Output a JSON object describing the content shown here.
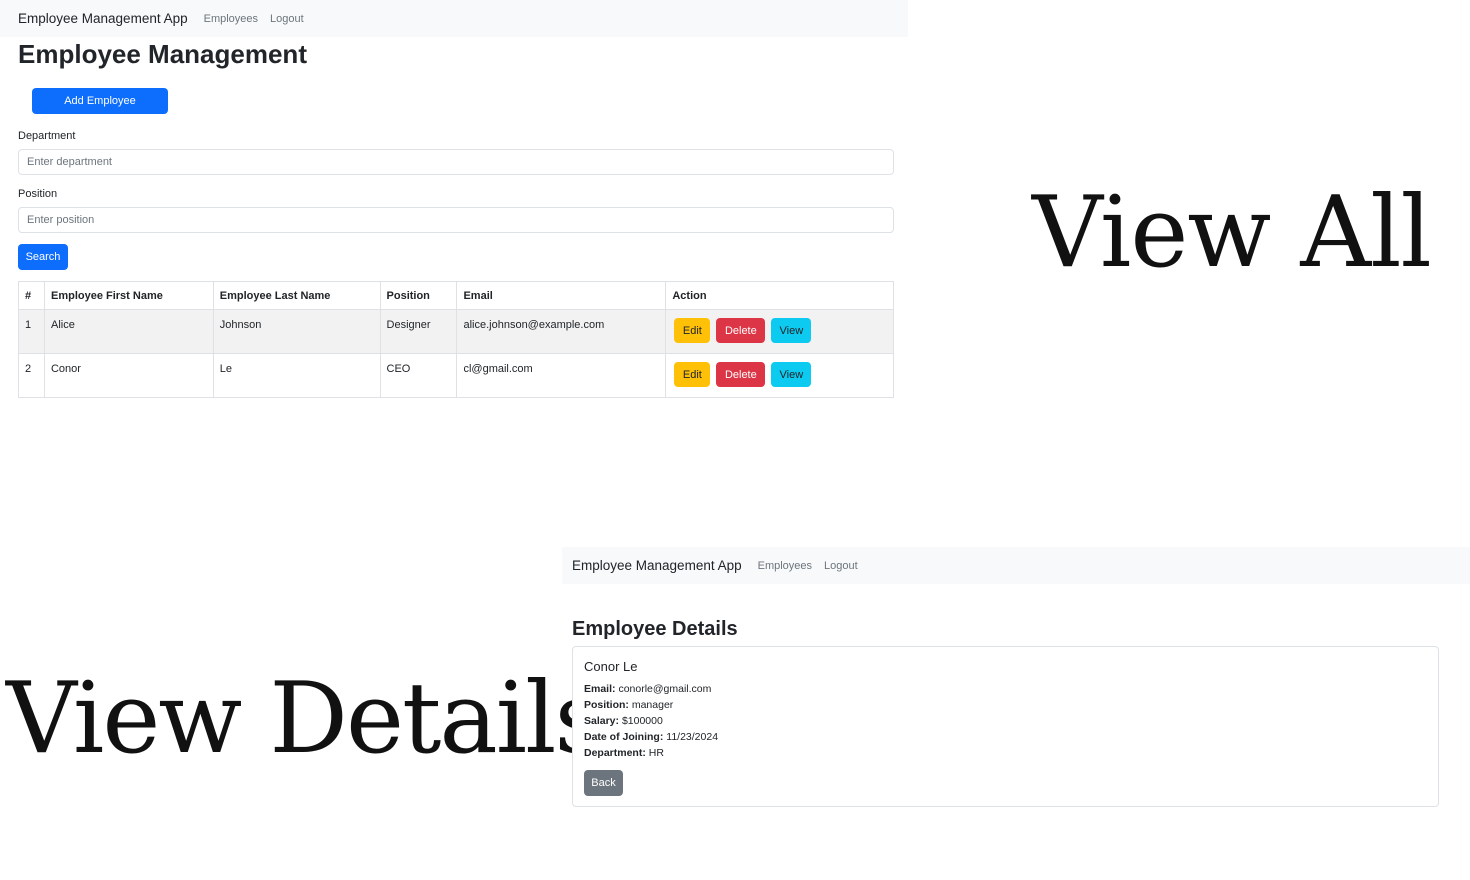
{
  "list_view": {
    "navbar": {
      "brand": "Employee Management App",
      "links": [
        "Employees",
        "Logout"
      ]
    },
    "title": "Employee Management",
    "add_button": "Add Employee",
    "department": {
      "label": "Department",
      "placeholder": "Enter department"
    },
    "position": {
      "label": "Position",
      "placeholder": "Enter position"
    },
    "search_button": "Search",
    "table": {
      "headers": [
        "#",
        "Employee First Name",
        "Employee Last Name",
        "Position",
        "Email",
        "Action"
      ],
      "rows": [
        {
          "num": "1",
          "first": "Alice",
          "last": "Johnson",
          "position": "Designer",
          "email": "alice.johnson@example.com"
        },
        {
          "num": "2",
          "first": "Conor",
          "last": "Le",
          "position": "CEO",
          "email": "cl@gmail.com"
        }
      ],
      "actions": {
        "edit": "Edit",
        "delete": "Delete",
        "view": "View"
      }
    }
  },
  "labels": {
    "view_all": "View All",
    "view_details": "View Details"
  },
  "details_view": {
    "navbar": {
      "brand": "Employee Management App",
      "links": [
        "Employees",
        "Logout"
      ]
    },
    "title": "Employee Details",
    "card": {
      "name": "Conor Le",
      "fields": [
        {
          "label": "Email:",
          "value": "conorle@gmail.com"
        },
        {
          "label": "Position:",
          "value": "manager"
        },
        {
          "label": "Salary:",
          "value": "$100000"
        },
        {
          "label": "Date of Joining:",
          "value": "11/23/2024"
        },
        {
          "label": "Department:",
          "value": "HR"
        }
      ],
      "back_button": "Back"
    }
  },
  "colors": {
    "primary": "#0d6efd",
    "warning": "#ffc107",
    "danger": "#dc3545",
    "info": "#0dcaf0",
    "secondary": "#6c757d",
    "navbar_bg": "#f8f9fa"
  }
}
